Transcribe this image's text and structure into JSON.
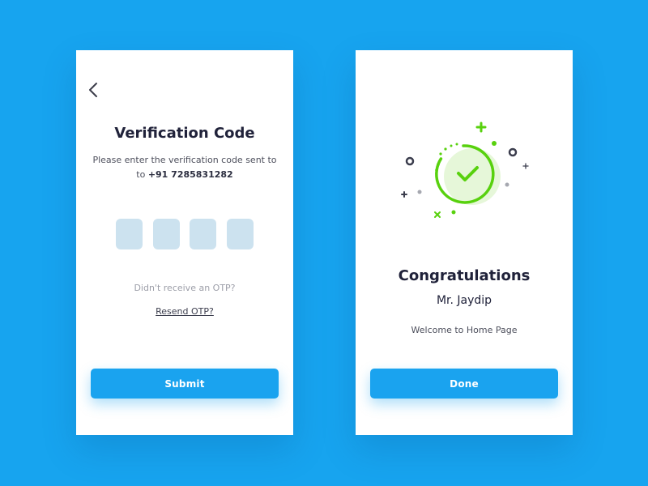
{
  "verification": {
    "title": "Verification Code",
    "description": "Please enter the verification code sent to",
    "phone": "+91 7285831282",
    "otp_values": [
      "",
      "",
      "",
      ""
    ],
    "no_otp_text": "Didn't receive an OTP?",
    "resend_label": "Resend OTP?",
    "submit_label": "Submit",
    "back_icon": "chevron-left-icon"
  },
  "success": {
    "title": "Congratulations",
    "name": "Mr. Jaydip",
    "welcome_text": "Welcome to Home Page",
    "done_label": "Done",
    "illustration_icon": "check-circle-icon"
  },
  "colors": {
    "background": "#17a4ef",
    "button": "#1aa3ef",
    "otp_box": "#cce2ef",
    "success_green": "#58d10e",
    "text_dark": "#20223a"
  }
}
